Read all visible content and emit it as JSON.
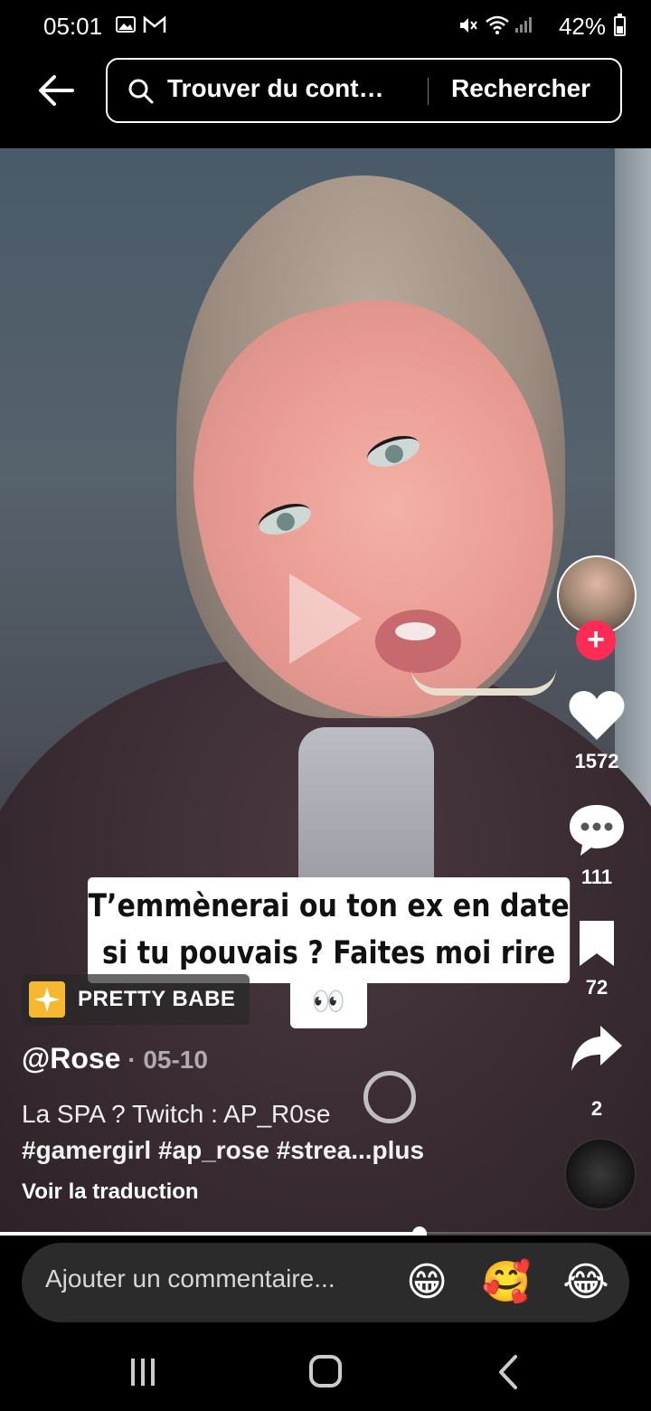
{
  "status_bar": {
    "time": "05:01",
    "battery": "42%",
    "battery_level": 0.42,
    "left_icons": [
      "gallery-icon",
      "gmail-icon"
    ],
    "right_icons": [
      "mute-icon",
      "wifi-icon",
      "signal-icon",
      "battery-icon"
    ]
  },
  "search": {
    "placeholder": "Trouver du cont…",
    "submit_label": "Rechercher"
  },
  "video": {
    "caption_line1": "T’emmènerai ou ton ex en date",
    "caption_line2": "si tu pouvais ? Faites moi rire",
    "caption_emoji": "👀",
    "progress": 0.645
  },
  "actions": {
    "likes": "1572",
    "comments": "111",
    "saves": "72",
    "shares": "2"
  },
  "effect": {
    "label": "PRETTY BABE"
  },
  "post": {
    "username": "@Rose",
    "date": " · 05-10",
    "description_line1": "La SPA ? Twitch : AP_R0se",
    "description_tags": "#gamergirl #ap_rose #strea...plus",
    "translate_link": "Voir la traduction"
  },
  "comment": {
    "placeholder": "Ajouter un commentaire...",
    "emojis": [
      "😁",
      "🥰",
      "😂"
    ]
  },
  "colors": {
    "accent": "#fe2c55",
    "effect_icon": "#f5b82e"
  }
}
